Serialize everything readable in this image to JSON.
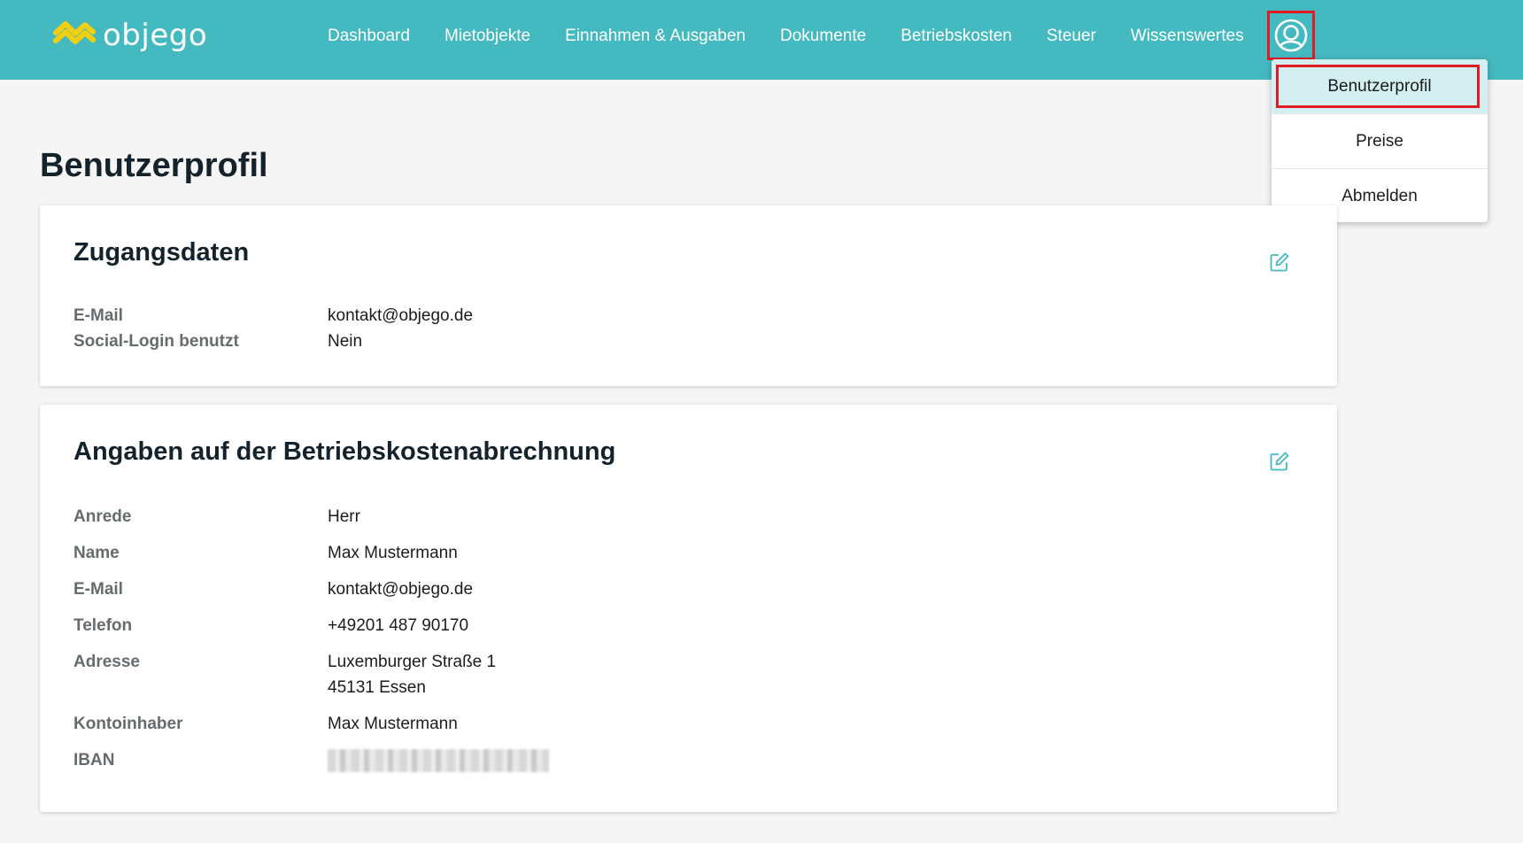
{
  "app": {
    "logo_text": "objego"
  },
  "nav": {
    "items": [
      {
        "label": "Dashboard"
      },
      {
        "label": "Mietobjekte"
      },
      {
        "label": "Einnahmen & Ausgaben"
      },
      {
        "label": "Dokumente"
      },
      {
        "label": "Betriebskosten"
      },
      {
        "label": "Steuer"
      },
      {
        "label": "Wissenswertes"
      }
    ],
    "user_icon": "user-circle-icon"
  },
  "dropdown": {
    "items": [
      {
        "label": "Benutzerprofil",
        "active": true
      },
      {
        "label": "Preise"
      },
      {
        "label": "Abmelden"
      }
    ]
  },
  "page": {
    "title": "Benutzerprofil"
  },
  "access": {
    "title": "Zugangsdaten",
    "edit_icon": "edit-icon",
    "rows": [
      {
        "label": "E-Mail",
        "value": "kontakt@objego.de"
      },
      {
        "label": "Social-Login benutzt",
        "value": "Nein"
      }
    ]
  },
  "billing": {
    "title": "Angaben auf der Betriebskostenabrechnung",
    "edit_icon": "edit-icon",
    "rows": [
      {
        "label": "Anrede",
        "value": "Herr"
      },
      {
        "label": "Name",
        "value": "Max Mustermann"
      },
      {
        "label": "E-Mail",
        "value": "kontakt@objego.de"
      },
      {
        "label": "Telefon",
        "value": "+49201 487 90170"
      },
      {
        "label": "Adresse",
        "value": "Luxemburger Straße 1",
        "value2": "45131 Essen"
      },
      {
        "label": "Kontoinhaber",
        "value": "Max Mustermann"
      },
      {
        "label": "IBAN"
      }
    ]
  },
  "colors": {
    "header": "#44b9c0",
    "logo_yellow": "#f3d00f",
    "highlight": "#e01b24",
    "active_item": "#d3eff1"
  }
}
